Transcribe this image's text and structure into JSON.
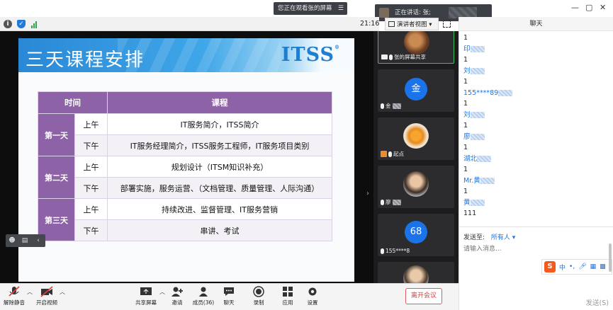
{
  "top_bar": {
    "sharing_status": "您正在观看张的屏幕",
    "speaking_label": "正在讲话: 张;",
    "view_mode": "演讲者视图",
    "clock": "21:16",
    "chat_panel_title": "聊天"
  },
  "slide": {
    "title": "三天课程安排",
    "logo": "ITSS",
    "logo_mark": "®",
    "table_headers": [
      "时间",
      "课程"
    ],
    "days": [
      {
        "day": "第一天",
        "rows": [
          {
            "period": "上午",
            "course": "IT服务简介，ITSS简介"
          },
          {
            "period": "下午",
            "course": "IT服务经理简介，ITSS服务工程师，IT服务项目类别"
          }
        ]
      },
      {
        "day": "第二天",
        "rows": [
          {
            "period": "上午",
            "course": "规划设计（ITSM知识补充）"
          },
          {
            "period": "下午",
            "course": "部署实施，服务运营、（文档管理、质量管理、人际沟通）"
          }
        ]
      },
      {
        "day": "第三天",
        "rows": [
          {
            "period": "上午",
            "course": "持续改进、监督管理、IT服务营销"
          },
          {
            "period": "下午",
            "course": "串讲、考试"
          }
        ]
      }
    ]
  },
  "participants": [
    {
      "name": "张的屏幕共享",
      "avatar": "photo"
    },
    {
      "name": "金",
      "avatar_text": "金"
    },
    {
      "name": "起点",
      "avatar": "photo"
    },
    {
      "name": "廖",
      "avatar": "photo"
    },
    {
      "name": "155****8",
      "avatar_text": "68"
    },
    {
      "name": "",
      "avatar": "photo"
    }
  ],
  "chat": {
    "lines": [
      {
        "type": "msg",
        "text": "1"
      },
      {
        "type": "name",
        "text": "印"
      },
      {
        "type": "msg",
        "text": "1"
      },
      {
        "type": "name",
        "text": "刘"
      },
      {
        "type": "msg",
        "text": "1"
      },
      {
        "type": "name",
        "text": "155****89"
      },
      {
        "type": "msg",
        "text": "1"
      },
      {
        "type": "name",
        "text": "刘"
      },
      {
        "type": "msg",
        "text": "1"
      },
      {
        "type": "name",
        "text": "廖"
      },
      {
        "type": "msg",
        "text": "1"
      },
      {
        "type": "name",
        "text": "湖北"
      },
      {
        "type": "msg",
        "text": "1"
      },
      {
        "type": "name",
        "text": "Mr.黄"
      },
      {
        "type": "msg",
        "text": "1"
      },
      {
        "type": "name",
        "text": "黄"
      },
      {
        "type": "msg",
        "text": "111"
      }
    ],
    "send_to_label": "发送至:",
    "send_to_value": "所有人",
    "input_placeholder": "请输入消息...",
    "send_button": "发送(S)",
    "ime_label": "中"
  },
  "toolbar": {
    "mute": "解除静音",
    "video": "开启视频",
    "share": "共享屏幕",
    "invite": "邀请",
    "members": "成员(36)",
    "chat": "聊天",
    "record": "录制",
    "apps": "应用",
    "settings": "设置",
    "leave": "离开会议"
  },
  "colors": {
    "accent_blue": "#1a73e8",
    "table_purple": "#8e62a6",
    "leave_red": "#e03c3c",
    "active_tile": "#3cbf5f"
  }
}
